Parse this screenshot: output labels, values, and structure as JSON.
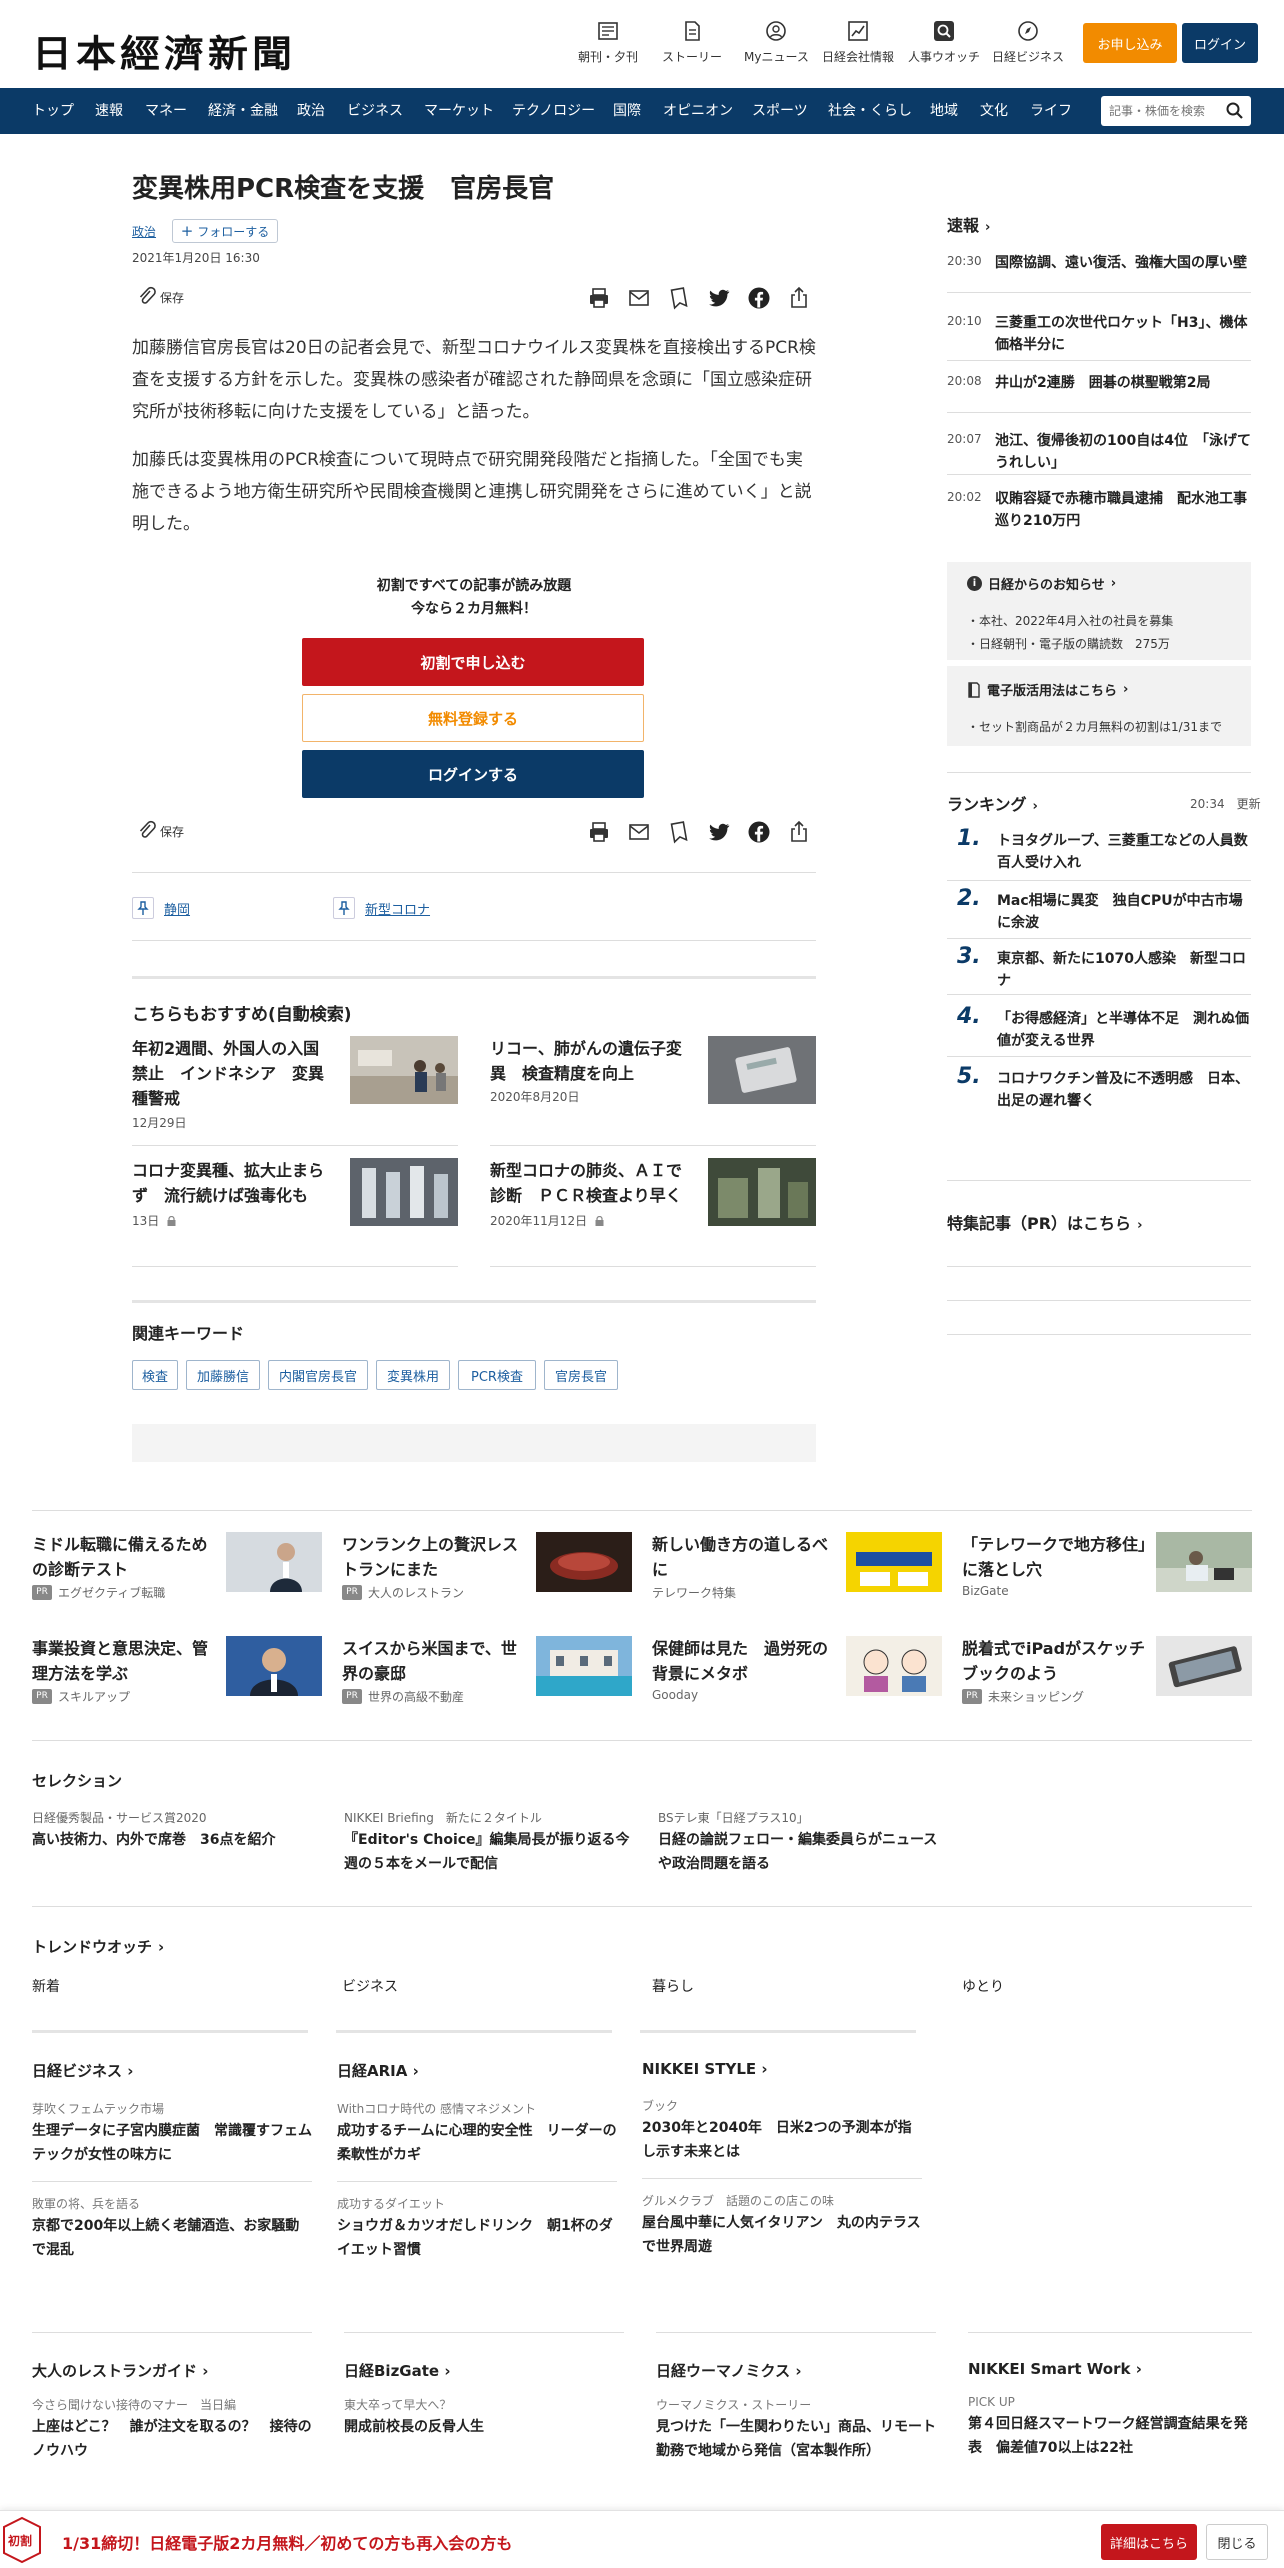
{
  "header": {
    "logo": "日本經濟新聞",
    "tools": [
      {
        "label": "朝刊・夕刊",
        "icon": "newspaper-icon"
      },
      {
        "label": "ストーリー",
        "icon": "story-icon"
      },
      {
        "label": "Myニュース",
        "icon": "user-icon"
      },
      {
        "label": "日経会社情報",
        "icon": "chart-icon"
      },
      {
        "label": "人事ウオッチ",
        "icon": "search-person-icon"
      },
      {
        "label": "日経ビジネス",
        "icon": "compass-icon"
      }
    ],
    "subscribe_label": "お申し込み",
    "login_label": "ログイン"
  },
  "nav": {
    "items": [
      "トップ",
      "速報",
      "マネー",
      "経済・金融",
      "政治",
      "ビジネス",
      "マーケット",
      "テクノロジー",
      "国際",
      "オピニオン",
      "スポーツ",
      "社会・くらし",
      "地域",
      "文化",
      "ライフ"
    ],
    "search_placeholder": "記事・株価を検索"
  },
  "article": {
    "title": "変異株用PCR検査を支援　官房長官",
    "category": "政治",
    "follow_label": "フォローする",
    "date": "2021年1月20日 16:30",
    "save_label": "保存",
    "paragraphs": [
      "加藤勝信官房長官は20日の記者会見で、新型コロナウイルス変異株を直接検出するPCR検査を支援する方針を示した。変異株の感染者が確認された静岡県を念頭に「国立感染症研究所が技術移転に向けた支援をしている」と語った。",
      "加藤氏は変異株用のPCR検査について現時点で研究開発段階だと指摘した。「全国でも実施できるよう地方衛生研究所や民間検査機関と連携し研究開発をさらに進めていく」と説明した。"
    ],
    "paywall_line1": "初割ですべての記事が読み放題",
    "paywall_line2": "今なら２カ月無料！",
    "btn_trial": "初割で申し込む",
    "btn_register": "無料登録する",
    "btn_login": "ログインする",
    "topics": [
      "静岡",
      "新型コロナ"
    ]
  },
  "recommend": {
    "heading": "こちらもおすすめ(自動検索)",
    "items": [
      {
        "title": "年初2週間、外国人の入国禁止　インドネシア　変異種警戒",
        "date": "12月29日",
        "locked": false
      },
      {
        "title": "リコー、肺がんの遺伝子変異　検査精度を向上",
        "date": "2020年8月20日",
        "locked": false
      },
      {
        "title": "コロナ変異種、拡大止まらず　流行続けば強毒化も",
        "date": "13日",
        "locked": true
      },
      {
        "title": "新型コロナの肺炎、ＡＩで診断　ＰＣＲ検査より早く",
        "date": "2020年11月12日",
        "locked": true
      }
    ]
  },
  "keywords": {
    "heading": "関連キーワード",
    "items": [
      "検査",
      "加藤勝信",
      "内閣官房長官",
      "変異株用",
      "PCR検査",
      "官房長官"
    ]
  },
  "sidebar": {
    "breaking_heading": "速報",
    "breaking": [
      {
        "time": "20:30",
        "text": "国際協調、遠い復活、強権大国の厚い壁"
      },
      {
        "time": "20:10",
        "text": "三菱重工の次世代ロケット「H3」、機体価格半分に"
      },
      {
        "time": "20:08",
        "text": "井山が2連勝　囲碁の棋聖戦第2局"
      },
      {
        "time": "20:07",
        "text": "池江、復帰後初の100自は4位　「泳げてうれしい」"
      },
      {
        "time": "20:02",
        "text": "収賄容疑で赤穂市職員逮捕　配水池工事巡り210万円"
      }
    ],
    "notice_heading": "日経からのお知らせ",
    "notices": [
      "本社、2022年4月入社の社員を募集",
      "日経朝刊・電子版の購読数　275万"
    ],
    "edition_heading": "電子版活用法はこちら",
    "edition_items": [
      "セット割商品が２カ月無料の初割は1/31まで"
    ],
    "ranking_heading": "ランキング",
    "ranking_time": "20:34",
    "ranking_update": "更新",
    "ranking": [
      {
        "n": "1.",
        "text": "トヨタグループ、三菱重工などの人員数百人受け入れ"
      },
      {
        "n": "2.",
        "text": "Mac相場に異変　独自CPUが中古市場に余波"
      },
      {
        "n": "3.",
        "text": "東京都、新たに1070人感染　新型コロナ"
      },
      {
        "n": "4.",
        "text": "「お得感経済」と半導体不足　測れぬ価値が変える世界"
      },
      {
        "n": "5.",
        "text": "コロナワクチン普及に不透明感　日本、出足の遅れ響く"
      }
    ],
    "pr_heading": "特集記事（PR）はこちら"
  },
  "ads": [
    {
      "title": "ミドル転職に備えるための診断テスト",
      "source": "エグゼクティブ転職",
      "pr": true
    },
    {
      "title": "ワンランク上の贅沢レストランにまた",
      "source": "大人のレストラン",
      "pr": true
    },
    {
      "title": "新しい働き方の道しるべに",
      "source": "テレワーク特集",
      "pr": false
    },
    {
      "title": "「テレワークで地方移住」に落とし穴",
      "source": "BizGate",
      "pr": false
    },
    {
      "title": "事業投資と意思決定、管理方法を学ぶ",
      "source": "スキルアップ",
      "pr": true
    },
    {
      "title": "スイスから米国まで、世界の豪邸",
      "source": "世界の高級不動産",
      "pr": true
    },
    {
      "title": "保健師は見た　過労死の背景にメタボ",
      "source": "Gooday",
      "pr": false
    },
    {
      "title": "脱着式でiPadがスケッチブックのよう",
      "source": "未来ショッピング",
      "pr": true
    }
  ],
  "selection": {
    "heading": "セレクション",
    "items": [
      {
        "kicker": "日経優秀製品・サービス賞2020",
        "title": "高い技術力、内外で席巻　36点を紹介"
      },
      {
        "kicker": "NIKKEI Briefing　新たに２タイトル",
        "title": "『Editor's Choice』編集局長が振り返る今週の５本をメールで配信"
      },
      {
        "kicker": "BSテレ東「日経プラス10」",
        "title": "日経の論説フェロー・編集委員らがニュースや政治問題を語る"
      }
    ]
  },
  "trend": {
    "heading": "トレンドウオッチ",
    "tabs": [
      "新着",
      "ビジネス",
      "暮らし",
      "ゆとり"
    ]
  },
  "media": [
    {
      "heading": "日経ビジネス",
      "items": [
        {
          "kicker": "芽吹くフェムテック市場",
          "title": "生理データに子宮内膜症菌　常識覆すフェムテックが女性の味方に"
        },
        {
          "kicker": "敗軍の将、兵を語る",
          "title": "京都で200年以上続く老舗酒造、お家騒動で混乱"
        }
      ]
    },
    {
      "heading": "日経ARIA",
      "items": [
        {
          "kicker": "Withコロナ時代の 感情マネジメント",
          "title": "成功するチームに心理的安全性　リーダーの柔軟性がカギ"
        },
        {
          "kicker": "成功するダイエット",
          "title": "ショウガ＆カツオだしドリンク　朝1杯のダイエット習慣"
        }
      ]
    },
    {
      "heading": "NIKKEI STYLE",
      "items": [
        {
          "kicker": "ブック",
          "title": "2030年と2040年　日米2つの予測本が指し示す未来とは"
        },
        {
          "kicker": "グルメクラブ　話題のこの店この味",
          "title": "屋台風中華に人気イタリアン　丸の内テラスで世界周遊"
        }
      ]
    }
  ],
  "media2": [
    {
      "heading": "大人のレストランガイド",
      "kicker": "今さら聞けない接待のマナー　当日編",
      "title": "上座はどこ？　誰が注文を取るの？　接待のノウハウ"
    },
    {
      "heading": "日経BizGate",
      "kicker": "東大卒って早大へ？",
      "title": "開成前校長の反骨人生"
    },
    {
      "heading": "日経ウーマノミクス",
      "kicker": "ウーマノミクス・ストーリー",
      "title": "見つけた「一生関わりたい」商品、リモート勤務で地域から発信（宮本製作所）"
    },
    {
      "heading": "NIKKEI Smart Work",
      "kicker": "PICK UP",
      "title": "第４回日経スマートワーク経営調査結果を発表　偏差値70以上は22社"
    }
  ],
  "banner": {
    "badge": "初割",
    "text": "1/31締切！日経電子版2カ月無料／初めての方も再入会の方も",
    "detail_label": "詳細はこちら",
    "close_label": "閉じる"
  },
  "colors": {
    "navy": "#0b3a67",
    "orange": "#f28b00",
    "red": "#c4161c",
    "link": "#1d5fa0"
  }
}
